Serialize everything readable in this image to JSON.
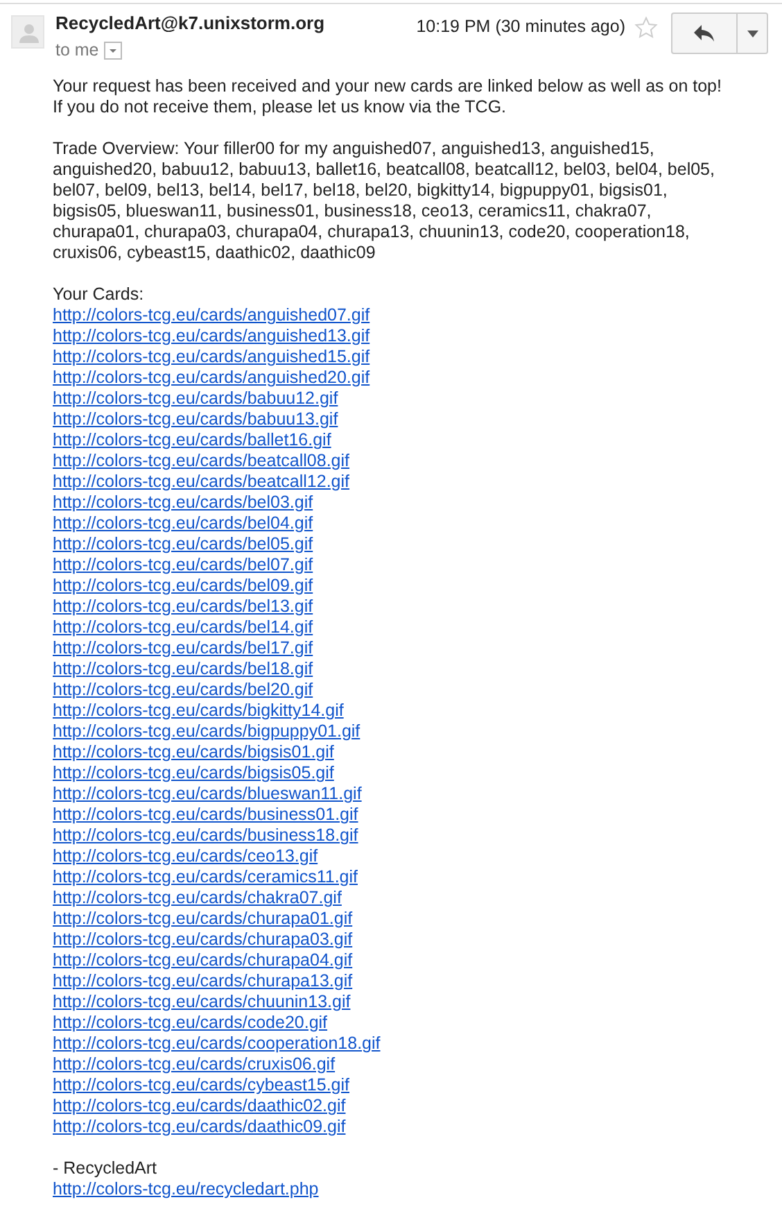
{
  "header": {
    "sender": "RecycledArt@k7.unixstorm.org",
    "recipient": "to me",
    "time": "10:19 PM (30 minutes ago)",
    "starred": false
  },
  "body": {
    "intro_lines": [
      "Your request has been received and your new cards are linked below as well as on top!",
      "If you do not receive them, please let us know via the TCG."
    ],
    "trade_overview": "Trade Overview: Your filler00 for my anguished07, anguished13, anguished15, anguished20, babuu12, babuu13, ballet16, beatcall08, beatcall12, bel03, bel04, bel05, bel07, bel09, bel13, bel14, bel17, bel18, bel20, bigkitty14, bigpuppy01, bigsis01, bigsis05, blueswan11, business01, business18, ceo13, ceramics11, chakra07, churapa01, churapa03, churapa04, churapa13, chuunin13, code20, cooperation18, cruxis06, cybeast15, daathic02, daathic09",
    "cards_heading": "Your Cards:",
    "card_links": [
      "http://colors-tcg.eu/cards/anguished07.gif",
      "http://colors-tcg.eu/cards/anguished13.gif",
      "http://colors-tcg.eu/cards/anguished15.gif",
      "http://colors-tcg.eu/cards/anguished20.gif",
      "http://colors-tcg.eu/cards/babuu12.gif",
      "http://colors-tcg.eu/cards/babuu13.gif",
      "http://colors-tcg.eu/cards/ballet16.gif",
      "http://colors-tcg.eu/cards/beatcall08.gif",
      "http://colors-tcg.eu/cards/beatcall12.gif",
      "http://colors-tcg.eu/cards/bel03.gif",
      "http://colors-tcg.eu/cards/bel04.gif",
      "http://colors-tcg.eu/cards/bel05.gif",
      "http://colors-tcg.eu/cards/bel07.gif",
      "http://colors-tcg.eu/cards/bel09.gif",
      "http://colors-tcg.eu/cards/bel13.gif",
      "http://colors-tcg.eu/cards/bel14.gif",
      "http://colors-tcg.eu/cards/bel17.gif",
      "http://colors-tcg.eu/cards/bel18.gif",
      "http://colors-tcg.eu/cards/bel20.gif",
      "http://colors-tcg.eu/cards/bigkitty14.gif",
      "http://colors-tcg.eu/cards/bigpuppy01.gif",
      "http://colors-tcg.eu/cards/bigsis01.gif",
      "http://colors-tcg.eu/cards/bigsis05.gif",
      "http://colors-tcg.eu/cards/blueswan11.gif",
      "http://colors-tcg.eu/cards/business01.gif",
      "http://colors-tcg.eu/cards/business18.gif",
      "http://colors-tcg.eu/cards/ceo13.gif",
      "http://colors-tcg.eu/cards/ceramics11.gif",
      "http://colors-tcg.eu/cards/chakra07.gif",
      "http://colors-tcg.eu/cards/churapa01.gif",
      "http://colors-tcg.eu/cards/churapa03.gif",
      "http://colors-tcg.eu/cards/churapa04.gif",
      "http://colors-tcg.eu/cards/churapa13.gif",
      "http://colors-tcg.eu/cards/chuunin13.gif",
      "http://colors-tcg.eu/cards/code20.gif",
      "http://colors-tcg.eu/cards/cooperation18.gif",
      "http://colors-tcg.eu/cards/cruxis06.gif",
      "http://colors-tcg.eu/cards/cybeast15.gif",
      "http://colors-tcg.eu/cards/daathic02.gif",
      "http://colors-tcg.eu/cards/daathic09.gif"
    ],
    "signature": "- RecycledArt",
    "signature_link": "http://colors-tcg.eu/recycledart.php"
  }
}
